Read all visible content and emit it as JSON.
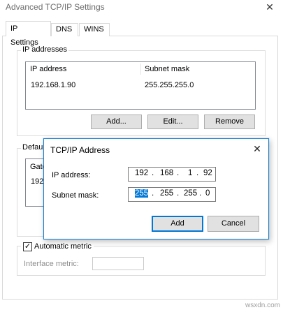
{
  "window": {
    "title": "Advanced TCP/IP Settings",
    "close_glyph": "✕"
  },
  "tabs": [
    {
      "label": "IP Settings",
      "active": true
    },
    {
      "label": "DNS",
      "active": false
    },
    {
      "label": "WINS",
      "active": false
    }
  ],
  "ip_addresses": {
    "legend": "IP addresses",
    "columns": [
      "IP address",
      "Subnet mask"
    ],
    "rows": [
      {
        "ip": "192.168.1.90",
        "mask": "255.255.255.0"
      }
    ],
    "add_label": "Add...",
    "edit_label": "Edit...",
    "remove_label": "Remove"
  },
  "gateways": {
    "legend_partial": "Defaul",
    "header_partial": "Gate",
    "row_partial": "192"
  },
  "dialog": {
    "title": "TCP/IP Address",
    "close_glyph": "✕",
    "ip_label": "IP address:",
    "ip_octets": [
      "192",
      "168",
      "1",
      "92"
    ],
    "mask_label": "Subnet mask:",
    "mask_octets": [
      "255",
      "255",
      "255",
      "0"
    ],
    "dot": ".",
    "add_label": "Add",
    "cancel_label": "Cancel"
  },
  "metric": {
    "checkbox_label": "Automatic metric",
    "checked_glyph": "✓",
    "interface_label": "Interface metric:"
  },
  "watermark": "wsxdn.com",
  "colors": {
    "accent": "#0078d7",
    "dialog_border": "#1883d7"
  }
}
